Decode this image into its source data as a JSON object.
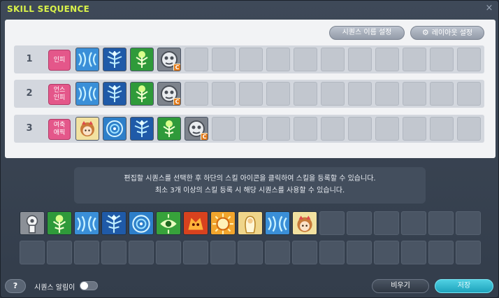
{
  "window": {
    "title": "SKILL SEQUENCE",
    "close_glyph": "×"
  },
  "header_buttons": {
    "rename": "시퀀스 이름 설정",
    "layout": "레이아웃 설정",
    "layout_icon": "gear-icon"
  },
  "sequences": [
    {
      "number": "1",
      "label": "인피",
      "skills": [
        "blue-wave",
        "blue-tree",
        "green-tree",
        "gray-orb-c"
      ]
    },
    {
      "number": "2",
      "label": "언스\n인피",
      "skills": [
        "blue-wave",
        "blue-tree",
        "green-tree",
        "gray-orb-c"
      ]
    },
    {
      "number": "3",
      "label": "여축\n애픽",
      "skills": [
        "pet-girl",
        "blue-circle",
        "blue-tree",
        "green-tree",
        "gray-orb-c"
      ]
    }
  ],
  "info": {
    "line1": "편집할 시퀀스를 선택한 후 하단의 스킬 아이콘을 클릭하여 스킬을 등록할 수 있습니다.",
    "line2": "최소 3개 이상의 스킬 등록 시 해당 시퀀스를 사용할 수 있습니다."
  },
  "palette_skills": [
    "gray-totem",
    "green-tree",
    "blue-wave",
    "blue-tree",
    "blue-circle",
    "green-eye",
    "red-dragon",
    "orange-sun",
    "gold-angel",
    "blue-wave",
    "pet-girl"
  ],
  "footer": {
    "help": "?",
    "alarm_label": "시퀀스 알림이",
    "alarm_on": false,
    "reset": "비우기",
    "save": "저장"
  },
  "colors": {
    "title": "#d8f04a",
    "label_pink": "#e4578a",
    "save_accent": "#1ea3bd"
  }
}
